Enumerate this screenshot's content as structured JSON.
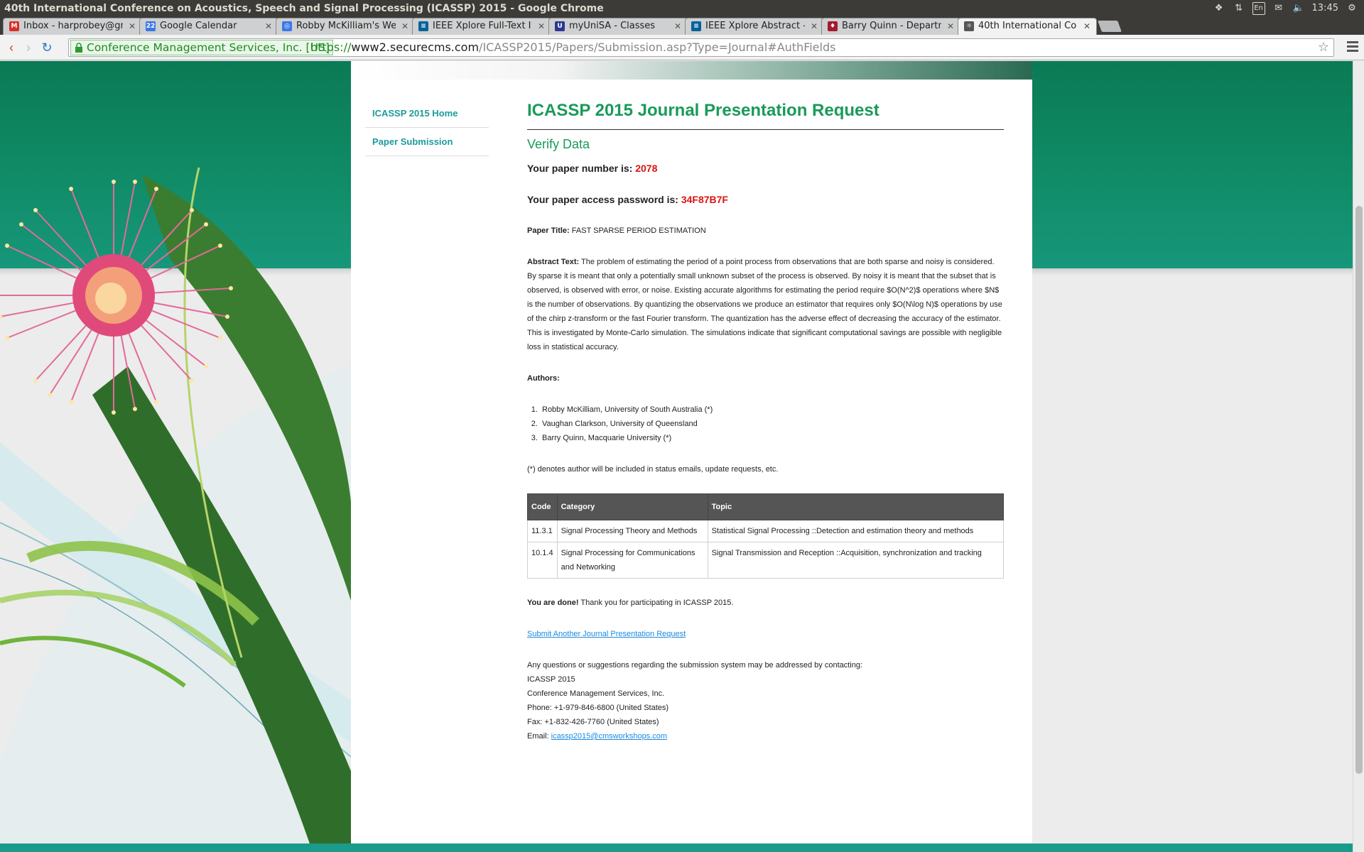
{
  "window": {
    "title": "40th International Conference on Acoustics, Speech and Signal Processing (ICASSP) 2015 - Google Chrome"
  },
  "tray": {
    "lang": "En",
    "time": "13:45"
  },
  "tabs": [
    {
      "label": "Inbox - harprobey@gm",
      "favicon": "gmail-icon",
      "color": "#d93025",
      "glyph": "M"
    },
    {
      "label": "Google Calendar",
      "favicon": "calendar-icon",
      "color": "#3b78e7",
      "glyph": "22"
    },
    {
      "label": "Robby McKilliam's We",
      "favicon": "globe-icon",
      "color": "#3b78e7",
      "glyph": "◎"
    },
    {
      "label": "IEEE Xplore Full-Text I",
      "favicon": "ieee-icon",
      "color": "#00629b",
      "glyph": "≡"
    },
    {
      "label": "myUniSA - Classes",
      "favicon": "unisa-icon",
      "color": "#2a3a8f",
      "glyph": "U"
    },
    {
      "label": "IEEE Xplore Abstract -",
      "favicon": "ieee-icon",
      "color": "#00629b",
      "glyph": "≡"
    },
    {
      "label": "Barry Quinn - Departm",
      "favicon": "mq-icon",
      "color": "#a6192e",
      "glyph": "♦"
    },
    {
      "label": "40th International Co",
      "favicon": "conference-icon",
      "color": "#555555",
      "glyph": "☼"
    }
  ],
  "omnibox": {
    "ev_label": "Conference Management Services, Inc. [US]",
    "scheme": "https://",
    "host": "www2.securecms.com",
    "path": "/ICASSP2015/Papers/Submission.asp?Type=Journal#AuthFields"
  },
  "sidebar": {
    "items": [
      {
        "label": "ICASSP 2015 Home"
      },
      {
        "label": "Paper Submission"
      }
    ]
  },
  "page": {
    "title": "ICASSP 2015 Journal Presentation Request",
    "section": "Verify Data",
    "paper_number_label": "Your paper number is:",
    "paper_number": "2078",
    "password_label": "Your paper access password is:",
    "password": "34F87B7F",
    "paper_title_label": "Paper Title:",
    "paper_title": "FAST SPARSE PERIOD ESTIMATION",
    "abstract_label": "Abstract Text:",
    "abstract": "The problem of estimating the period of a point process from observations that are both sparse and noisy is considered. By sparse it is meant that only a potentially small unknown subset of the process is observed. By noisy it is meant that the subset that is observed, is observed with error, or noise. Existing accurate algorithms for estimating the period require $O(N^2)$ operations where $N$ is the number of observations. By quantizing the observations we produce an estimator that requires only $O(N\\log N)$ operations by use of the chirp z-transform or the fast Fourier transform. The quantization has the adverse effect of decreasing the accuracy of the estimator. This is investigated by Monte-Carlo simulation. The simulations indicate that significant computational savings are possible with negligible loss in statistical accuracy.",
    "authors_label": "Authors:",
    "authors": [
      "Robby McKilliam, University of South Australia (*)",
      "Vaughan Clarkson, University of Queensland",
      "Barry Quinn, Macquarie University (*)"
    ],
    "denotes_note": "(*) denotes author will be included in status emails, update requests, etc.",
    "table": {
      "headers": [
        "Code",
        "Category",
        "Topic"
      ],
      "rows": [
        [
          "11.3.1",
          "Signal Processing Theory and Methods",
          "Statistical Signal Processing ::Detection and estimation theory and methods"
        ],
        [
          "10.1.4",
          "Signal Processing for Communications and Networking",
          "Signal Transmission and Reception ::Acquisition, synchronization and tracking"
        ]
      ]
    },
    "done_bold": "You are done!",
    "done_text": " Thank you for participating in ICASSP 2015.",
    "another_link": "Submit Another Journal Presentation Request",
    "contact": {
      "intro": "Any questions or suggestions regarding the submission system may be addressed by contacting:",
      "org": "ICASSP 2015",
      "company": "Conference Management Services, Inc.",
      "phone": "Phone: +1-979-846-6800 (United States)",
      "fax": "Fax: +1-832-426-7760 (United States)",
      "email_label": "Email: ",
      "email": "icassp2015@cmsworkshops.com"
    }
  },
  "colors": {
    "heading": "#1a9a5a",
    "highlight": "#dd1111",
    "nav": "#1d9a9a",
    "band": "#0f8a64"
  }
}
